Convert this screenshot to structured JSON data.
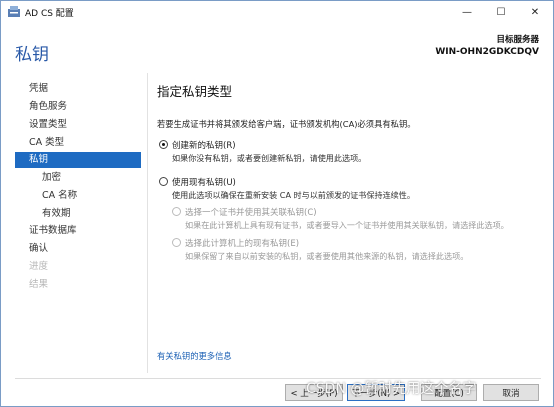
{
  "window": {
    "title": "AD CS 配置",
    "minimize_glyph": "—",
    "maximize_glyph": "☐",
    "close_glyph": "✕"
  },
  "header": {
    "title": "私钥",
    "target_label": "目标服务器",
    "target_server": "WIN-OHN2GDKCDQV"
  },
  "sidebar": {
    "items": [
      {
        "label": "凭据",
        "state": "normal"
      },
      {
        "label": "角色服务",
        "state": "normal"
      },
      {
        "label": "设置类型",
        "state": "normal"
      },
      {
        "label": "CA 类型",
        "state": "normal"
      },
      {
        "label": "私钥",
        "state": "active"
      },
      {
        "label": "加密",
        "state": "sub"
      },
      {
        "label": "CA 名称",
        "state": "sub"
      },
      {
        "label": "有效期",
        "state": "sub"
      },
      {
        "label": "证书数据库",
        "state": "normal"
      },
      {
        "label": "确认",
        "state": "normal"
      },
      {
        "label": "进度",
        "state": "disabled"
      },
      {
        "label": "结果",
        "state": "disabled"
      }
    ]
  },
  "content": {
    "section_title": "指定私钥类型",
    "intro": "若要生成证书并将其颁发给客户端，证书颁发机构(CA)必须具有私钥。",
    "option_new": {
      "label": "创建新的私钥(R)",
      "description": "如果你没有私钥，或者要创建新私钥，请使用此选项。",
      "checked": true
    },
    "option_existing": {
      "label": "使用现有私钥(U)",
      "description": "使用此选项以确保在重新安装 CA 时与以前颁发的证书保持连续性。",
      "checked": false,
      "sub_option_cert": {
        "label": "选择一个证书并使用其关联私钥(C)",
        "description": "如果在此计算机上具有现有证书，或者要导入一个证书并使用其关联私钥，请选择此选项。"
      },
      "sub_option_key": {
        "label": "选择此计算机上的现有私钥(E)",
        "description": "如果保留了来自以前安装的私钥，或者要使用其他来源的私钥，请选择此选项。"
      }
    },
    "more_info_link": "有关私钥的更多信息"
  },
  "footer": {
    "prev_label": "< 上一步(P)",
    "next_label": "下一步(N) >",
    "configure_label": "配置(C)",
    "cancel_label": "取消",
    "watermark": "CSDN @暂时先用这个名字"
  }
}
